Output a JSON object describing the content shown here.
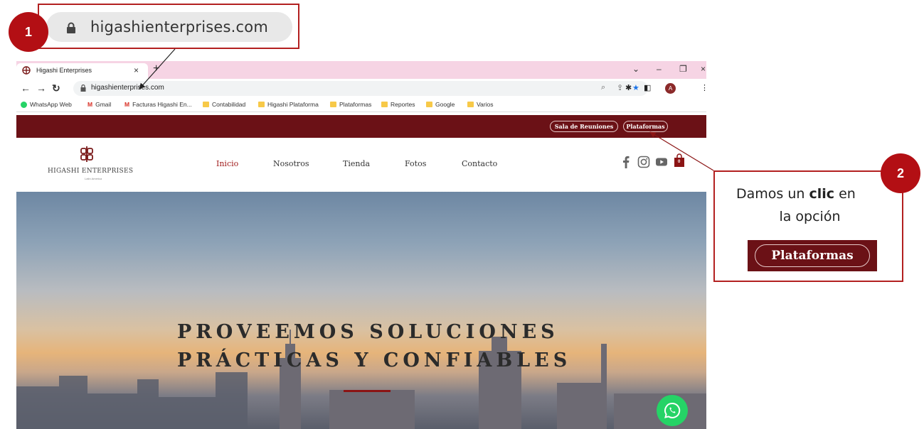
{
  "callout_1": {
    "badge": "1",
    "url": "higashienterprises.com"
  },
  "callout_2": {
    "badge": "2",
    "text_before": "Damos un ",
    "text_bold": "clic",
    "text_after": " en",
    "text_line2": "la opción",
    "button_label": "Plataformas"
  },
  "browser": {
    "tab_title": "Higashi Enterprises",
    "tab_close": "×",
    "new_tab": "+",
    "url": "higashienterprises.com",
    "avatar_letter": "A",
    "bookmarks": [
      "WhatsApp Web",
      "Gmail",
      "Facturas Higashi En...",
      "Contabilidad",
      "Higashi Plataforma",
      "Plataformas",
      "Reportes",
      "Google",
      "Varios"
    ]
  },
  "site": {
    "top_buttons": [
      "Sala de Reuniones",
      "Plataformas"
    ],
    "logo_name": "HIGASHI ENTERPRISES",
    "logo_sub": "Latin America",
    "menu": [
      "Inicio",
      "Nosotros",
      "Tienda",
      "Fotos",
      "Contacto"
    ],
    "active_menu": "Inicio",
    "cart_count": "0",
    "hero_line1": "PROVEEMOS SOLUCIONES",
    "hero_line2": "PRÁCTICAS Y CONFIABLES"
  },
  "colors": {
    "brand_dark_red": "#6b1116",
    "accent_red": "#a01b1b",
    "callout_red": "#b30f14",
    "whatsapp": "#25d366",
    "tab_strip": "#f6d4e4"
  }
}
